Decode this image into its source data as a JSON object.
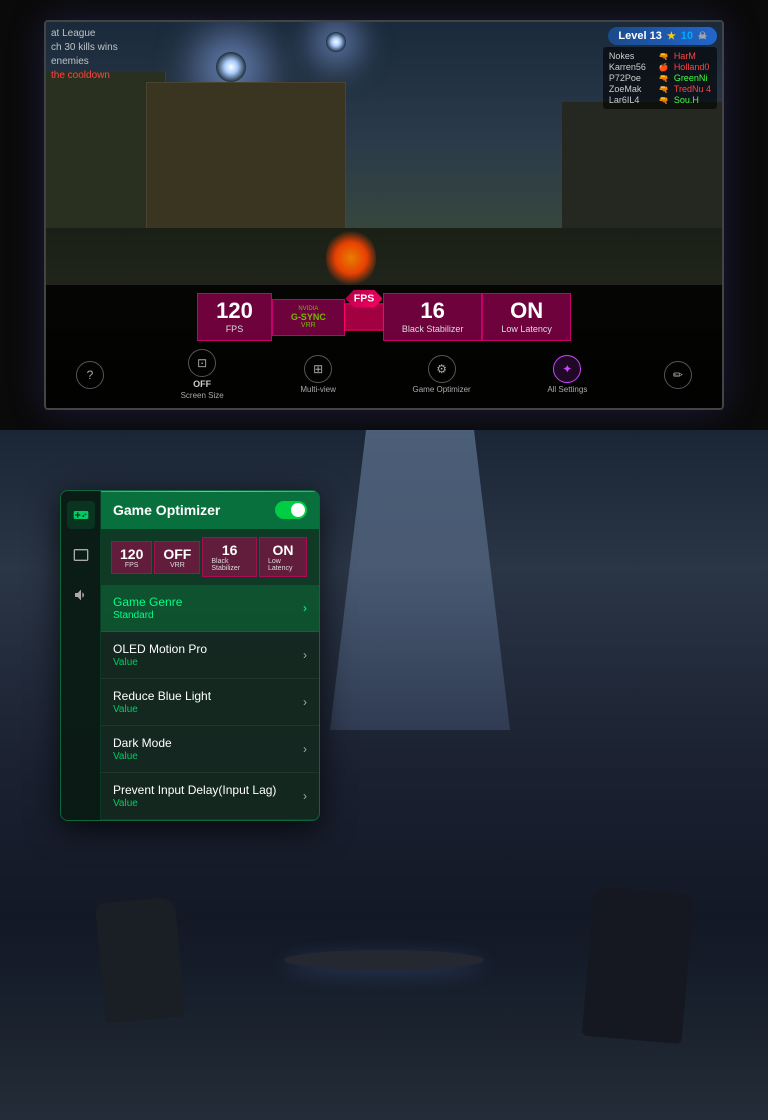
{
  "top": {
    "hud": {
      "top_left": {
        "line1": "at League",
        "line2": "ch 30 kills wins",
        "line3": "enemies",
        "line4": "the cooldown"
      },
      "level": "Level 13",
      "scoreboard": [
        {
          "name": "Nokes",
          "team": "gun",
          "score": "HarM",
          "color": "red"
        },
        {
          "name": "Karren56",
          "team": "apple",
          "score": "Holland0",
          "color": "red"
        },
        {
          "name": "P72Poe",
          "team": "gun",
          "score": "GreenNi",
          "color": "green"
        },
        {
          "name": "ZoeMak",
          "team": "gun",
          "score": "TredNu 4",
          "color": "red"
        },
        {
          "name": "Lar6IL4",
          "team": "gun",
          "score": "Sou.H",
          "color": "green"
        }
      ]
    },
    "stats": {
      "fps_value": "120",
      "fps_label": "FPS",
      "gsync_label": "G-SYNC",
      "gsync_sub": "VRR",
      "fps_badge": "FPS",
      "black_stab_value": "16",
      "black_stab_label": "Black Stabilizer",
      "latency_value": "ON",
      "latency_label": "Low Latency"
    },
    "controls": {
      "screen_size_label": "Screen Size",
      "screen_size_value": "OFF",
      "multi_view_label": "Multi-view",
      "optimizer_label": "Game Optimizer",
      "all_settings_label": "All Settings"
    }
  },
  "bottom": {
    "panel": {
      "title": "Game Optimizer",
      "toggle_on": true,
      "stats": {
        "fps": {
          "value": "120",
          "label": "FPS"
        },
        "vrr": {
          "value": "OFF",
          "label": "VRR"
        },
        "black_stab": {
          "value": "16",
          "label": "Black Stabilizer"
        },
        "latency": {
          "value": "ON",
          "label": "Low Latency"
        }
      },
      "menu_items": [
        {
          "name": "Game Genre",
          "value": "Standard",
          "highlighted": true
        },
        {
          "name": "OLED Motion Pro",
          "value": "Value",
          "highlighted": false
        },
        {
          "name": "Reduce Blue Light",
          "value": "Value",
          "highlighted": false
        },
        {
          "name": "Dark Mode",
          "value": "Value",
          "highlighted": false
        },
        {
          "name": "Prevent Input Delay(Input Lag)",
          "value": "Value",
          "highlighted": false
        }
      ],
      "sidebar_icons": [
        "gamepad",
        "display",
        "volume",
        "settings"
      ]
    }
  }
}
